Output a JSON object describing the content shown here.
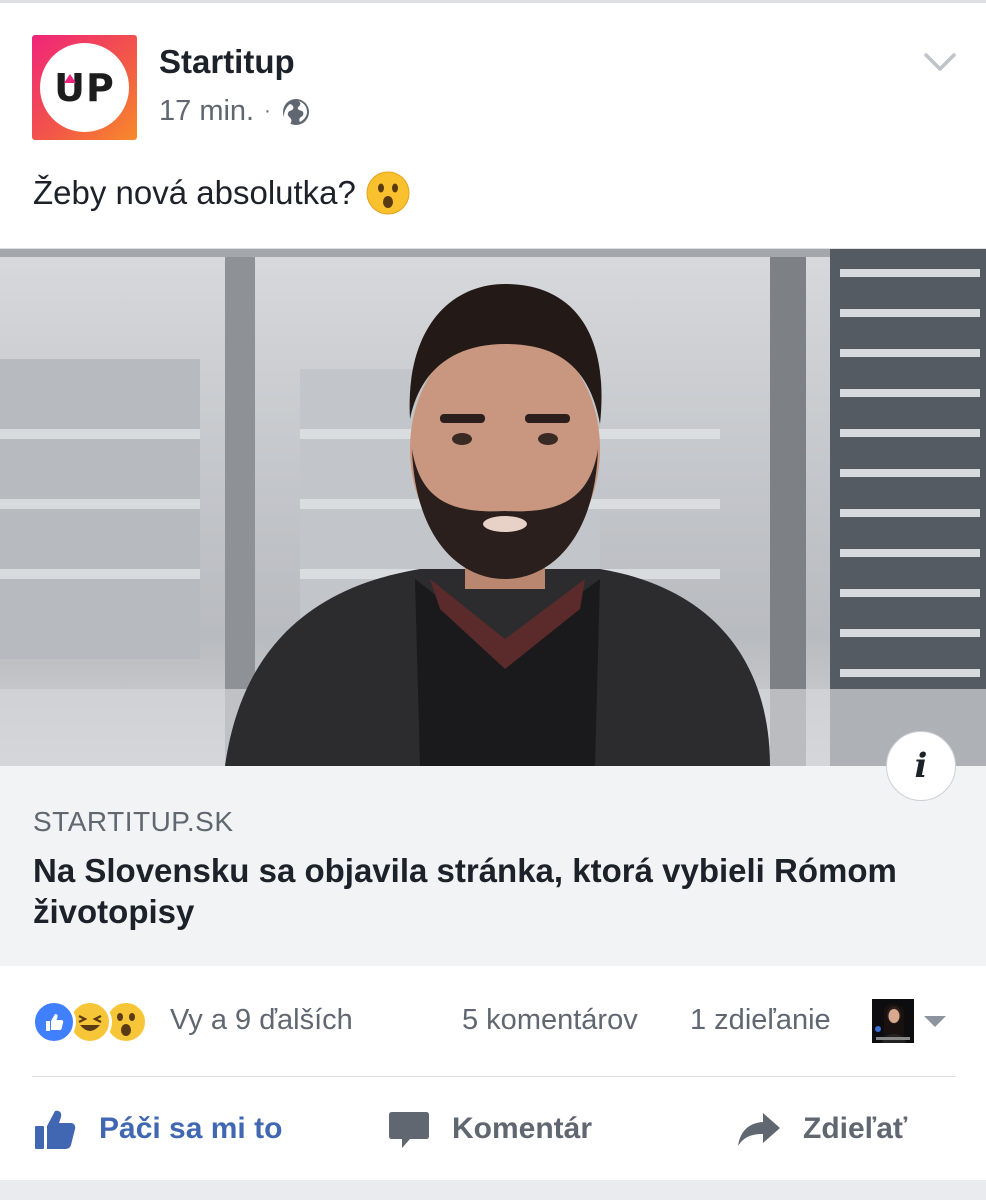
{
  "post": {
    "page_name": "Startitup",
    "avatar_text": "UP",
    "time": "17 min.",
    "separator": "·",
    "privacy_icon": "globe-icon",
    "menu_icon": "chevron-down-icon",
    "text": "Žeby nová absolutka?",
    "text_emoji": "astonished-face-emoji"
  },
  "link_preview": {
    "domain": "STARTITUP.SK",
    "headline": "Na Slovensku sa objavila stránka, ktorá vybieli Rómom životopisy",
    "info_label": "i"
  },
  "stats": {
    "reaction_icons": [
      "like-reaction-icon",
      "haha-reaction-icon",
      "wow-reaction-icon"
    ],
    "reactions_text": "Vy a 9 ďalších",
    "comments_text": "5 komentárov",
    "shares_text": "1 zdieľanie"
  },
  "actions": {
    "like_label": "Páči sa mi to",
    "comment_label": "Komentár",
    "share_label": "Zdieľať"
  },
  "colors": {
    "like_blue": "#4267b2",
    "secondary_text": "#606770",
    "link_box_bg": "#f2f3f5",
    "brand_gradient_start": "#f0247a",
    "brand_gradient_end": "#f78b2a"
  }
}
